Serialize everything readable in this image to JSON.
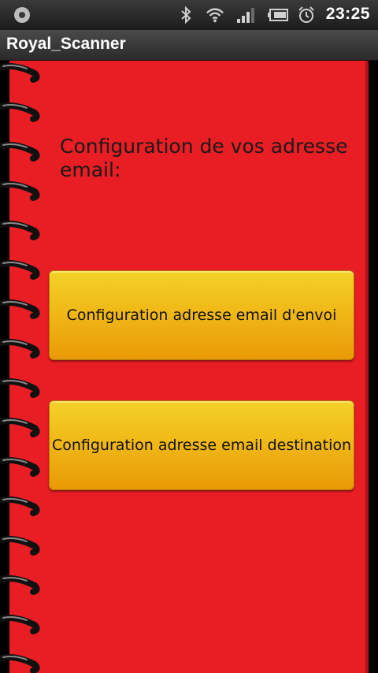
{
  "statusbar": {
    "time": "23:25",
    "icons": [
      "app-notification-icon",
      "bluetooth-icon",
      "wifi-icon",
      "signal-icon",
      "battery-icon",
      "alarm-clock-icon"
    ]
  },
  "titlebar": {
    "title": "Royal_Scanner"
  },
  "main": {
    "heading": "Configuration de vos adresse email:",
    "buttons": [
      {
        "label": "Configuration adresse email d'envoi"
      },
      {
        "label": "Configuration adresse email destination"
      }
    ]
  },
  "colors": {
    "page_background": "#e91d24",
    "button_gradient_top": "#f3d227",
    "button_gradient_bottom": "#e99a05",
    "spiral": "#111111"
  }
}
